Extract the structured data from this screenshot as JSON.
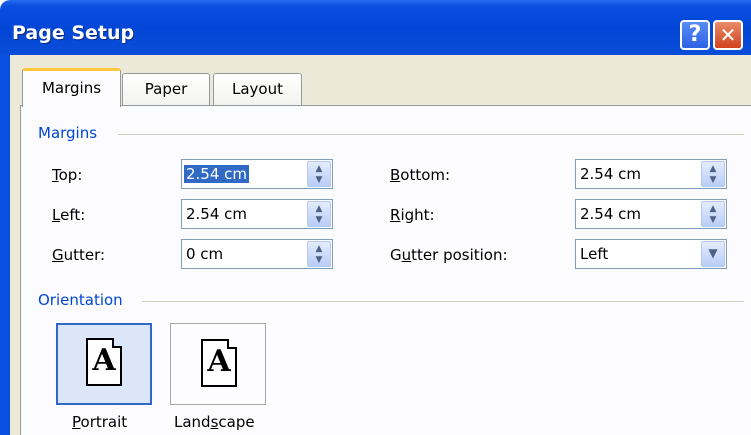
{
  "window": {
    "title": "Page Setup",
    "help_icon": "?",
    "close_icon": "✕"
  },
  "tabs": [
    {
      "label": "Margins",
      "active": true
    },
    {
      "label": "Paper",
      "active": false
    },
    {
      "label": "Layout",
      "active": false
    }
  ],
  "margins_group": {
    "label": "Margins",
    "fields": {
      "top": {
        "label_accel": "T",
        "label_rest": "op:",
        "value": "2.54 cm"
      },
      "left": {
        "label_accel": "L",
        "label_rest": "eft:",
        "value": "2.54 cm"
      },
      "gutter": {
        "label_accel": "G",
        "label_rest": "utter:",
        "value": "0 cm"
      },
      "bottom": {
        "label_accel": "B",
        "label_rest": "ottom:",
        "value": "2.54 cm"
      },
      "right": {
        "label_accel": "R",
        "label_rest": "ight:",
        "value": "2.54 cm"
      },
      "gutter_position": {
        "label_pre": "G",
        "label_accel": "u",
        "label_rest": "tter position:",
        "value": "Left"
      }
    }
  },
  "orientation_group": {
    "label": "Orientation",
    "portrait": {
      "label_accel": "P",
      "label_rest": "ortrait",
      "glyph": "A",
      "selected": true
    },
    "landscape": {
      "label_pre": "Land",
      "label_accel": "s",
      "label_rest": "cape",
      "glyph": "A",
      "selected": false
    }
  },
  "colors": {
    "title_bar": "#0146d6",
    "group_label": "#0046d5",
    "selection": "#316ac5",
    "tab_highlight": "#ffc83c"
  }
}
